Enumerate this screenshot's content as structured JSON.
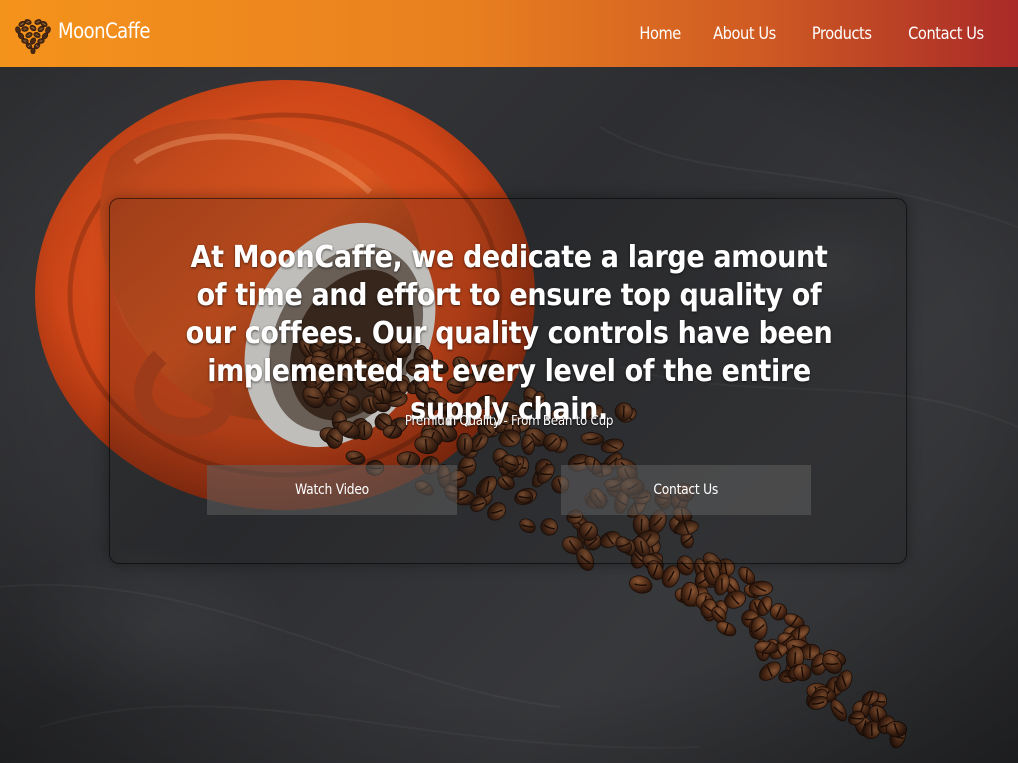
{
  "brand": {
    "name": "MoonCaffe",
    "logo_icon": "coffee-bean-heart-icon"
  },
  "nav": {
    "items": [
      {
        "label": "Home"
      },
      {
        "label": "About Us"
      },
      {
        "label": "Products"
      },
      {
        "label": "Contact Us"
      }
    ]
  },
  "hero": {
    "headline": "At MoonCaffe, we dedicate a large amount of time and effort to ensure top quality of our coffees. Our quality controls have been implemented at every level of the entire supply chain.",
    "tagline": "Premium Quality - From Bean to Cup",
    "buttons": {
      "watch_video": "Watch Video",
      "contact_us": "Contact Us"
    }
  },
  "colors": {
    "header_gradient_start": "#f4931c",
    "header_gradient_end": "#a92a28",
    "cup_orange": "#d24a1c",
    "slate_background": "#2f3033"
  }
}
